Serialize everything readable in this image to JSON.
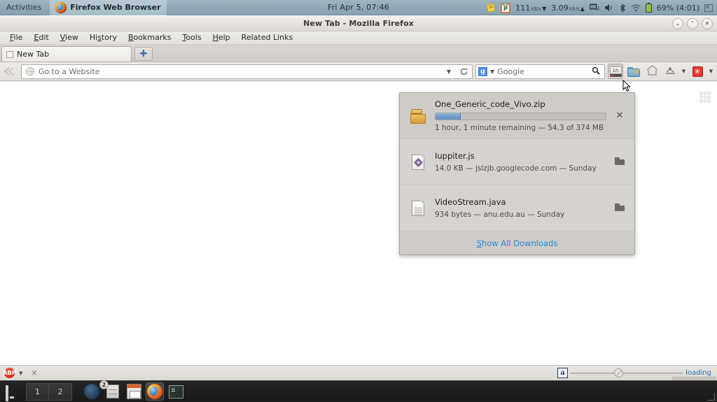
{
  "desktop": {
    "topbar": {
      "activities": "Activities",
      "app_menu": "Firefox Web Browser",
      "app_icon": "firefox-icon",
      "clock": "Fri Apr  5, 07:46",
      "tray": {
        "note_icon": "sticky-note-icon",
        "clipboard_icon": "clipboard-icon",
        "download_rate": "111",
        "download_unit": "kB/s",
        "download_arrow": "▼",
        "upload_rate": "3.09",
        "upload_unit": "kB/s",
        "upload_arrow": "▲",
        "network_icon": "network-wired-icon",
        "volume_icon": "volume-icon",
        "bluetooth_icon": "bluetooth-icon",
        "wifi_icon": "wifi-icon",
        "battery_icon": "battery-icon",
        "battery_text": "69% (4:01)",
        "menu_icon": "system-menu-icon"
      }
    },
    "taskbar": {
      "show_desktop_icon": "monitor-icon",
      "workspaces": [
        "1",
        "2"
      ],
      "launchers": [
        {
          "name": "thunderbird",
          "icon": "thunderbird-icon",
          "badge": ""
        },
        {
          "name": "file-manager",
          "icon": "file-cabinet-icon",
          "badge": "2"
        },
        {
          "name": "libreoffice-impress",
          "icon": "impress-icon",
          "badge": ""
        },
        {
          "name": "firefox",
          "icon": "firefox-icon",
          "badge": ""
        },
        {
          "name": "terminal",
          "icon": "terminal-icon",
          "badge": ""
        }
      ]
    }
  },
  "browser": {
    "window_title": "New Tab - Mozilla Firefox",
    "window_buttons": {
      "minimize": "⌄",
      "maximize": "⌃",
      "close": "✕"
    },
    "menubar": [
      {
        "name": "file",
        "pre": "",
        "key": "F",
        "post": "ile"
      },
      {
        "name": "edit",
        "pre": "",
        "key": "E",
        "post": "dit"
      },
      {
        "name": "view",
        "pre": "",
        "key": "V",
        "post": "iew"
      },
      {
        "name": "history",
        "pre": "Hi",
        "key": "s",
        "post": "tory"
      },
      {
        "name": "bookmarks",
        "pre": "",
        "key": "B",
        "post": "ookmarks"
      },
      {
        "name": "tools",
        "pre": "",
        "key": "T",
        "post": "ools"
      },
      {
        "name": "help",
        "pre": "",
        "key": "H",
        "post": "elp"
      },
      {
        "name": "related-links",
        "pre": "Related Links",
        "key": "",
        "post": ""
      }
    ],
    "tabs": [
      {
        "label": "New Tab",
        "favicon": "blank-page-icon"
      }
    ],
    "new_tab_button": "✚",
    "navbar": {
      "back_icon": "back-arrow-icon",
      "url_placeholder": "Go to a Website",
      "url_value": "",
      "url_globe_icon": "globe-icon",
      "url_dropdown_icon": "chevron-down-icon",
      "url_reload_icon": "reload-icon",
      "search_engine": "Google",
      "search_engine_icon": "google-icon",
      "search_engine_letter": "g",
      "search_placeholder": "Google",
      "search_value": "",
      "search_dropdown_icon": "chevron-down-icon",
      "search_magnifier_icon": "magnifier-icon",
      "toolbar_icons": [
        {
          "name": "downloads-button",
          "icon": "download-icon",
          "label": "1h",
          "state": "pressed"
        },
        {
          "name": "bookmarks-button",
          "icon": "bookmarks-folder-star-icon",
          "label": ""
        },
        {
          "name": "home-button",
          "icon": "home-icon",
          "label": ""
        },
        {
          "name": "plugin-button",
          "icon": "plugin-icon",
          "label": ""
        },
        {
          "name": "addon-button",
          "icon": "addon-asterisk-icon",
          "label": "✳"
        }
      ]
    },
    "content": {
      "grid_icon": "grid-icon"
    },
    "downloads_panel": {
      "items": [
        {
          "filename": "One_Generic_code_Vivo.zip",
          "status": "1 hour, 1 minute remaining — 54.3 of 374 MB",
          "file_icon": "zip-archive-icon",
          "progress_percent": 15,
          "action": "cancel",
          "action_icon": "close-icon",
          "action_glyph": "✕"
        },
        {
          "filename": "Iuppiter.js",
          "status": "14.0 KB — jslzjb.googlecode.com — Sunday",
          "file_icon": "javascript-file-icon",
          "progress_percent": null,
          "action": "open-folder",
          "action_icon": "folder-icon",
          "action_glyph": ""
        },
        {
          "filename": "VideoStream.java",
          "status": "934 bytes — anu.edu.au — Sunday",
          "file_icon": "java-file-icon",
          "progress_percent": null,
          "action": "open-folder",
          "action_icon": "folder-icon",
          "action_glyph": ""
        }
      ],
      "footer": {
        "link_key": "S",
        "link_rest": "how All Downloads"
      }
    },
    "statusbar": {
      "adblock_icon": "adblock-plus-icon",
      "adblock_label": "ABP",
      "adblock_caret": "▼",
      "close_icon": "close-icon",
      "close_glyph": "✕",
      "abp_right_icon": "abp-icon",
      "abp_right_label": "a",
      "slider_icon": "no-entry-icon",
      "loading_text": "loading"
    }
  }
}
